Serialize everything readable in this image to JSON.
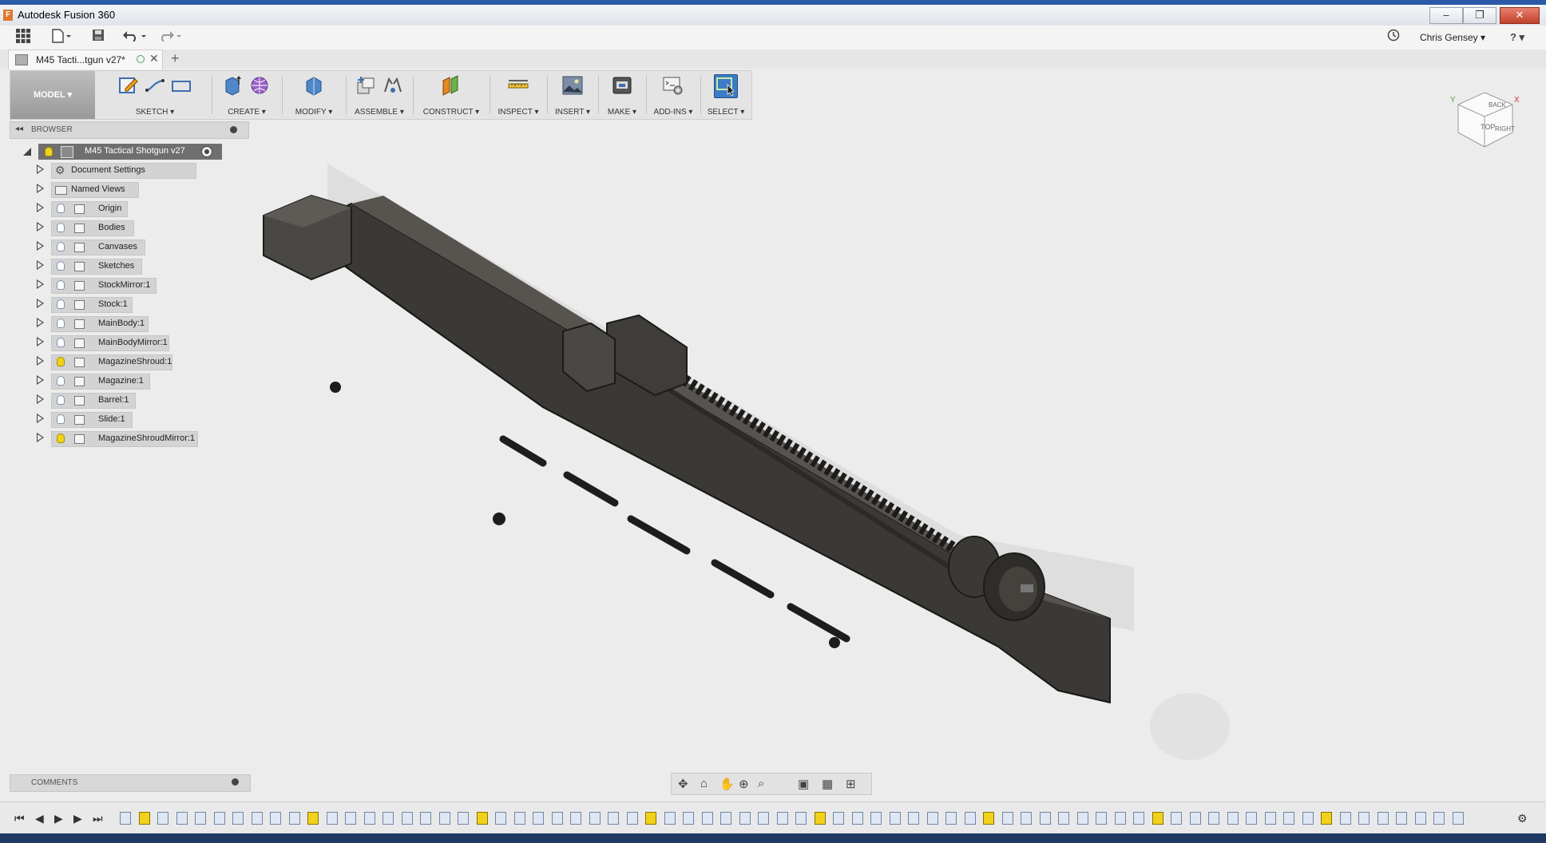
{
  "window": {
    "title": "Autodesk Fusion 360",
    "logo": "F",
    "controls": [
      "–",
      "❐",
      "✕"
    ]
  },
  "quickbar": {
    "user": "Chris Gensey ▾",
    "help": "? ▾"
  },
  "document_tab": {
    "label": "M45 Tacti...tgun v27*"
  },
  "toolbar": {
    "workspace": "MODEL ▾",
    "groups": [
      {
        "label": "SKETCH ▾"
      },
      {
        "label": "CREATE ▾"
      },
      {
        "label": "MODIFY ▾"
      },
      {
        "label": "ASSEMBLE ▾"
      },
      {
        "label": "CONSTRUCT ▾"
      },
      {
        "label": "INSPECT ▾"
      },
      {
        "label": "INSERT ▾"
      },
      {
        "label": "MAKE ▾"
      },
      {
        "label": "ADD-INS ▾"
      },
      {
        "label": "SELECT ▾"
      }
    ]
  },
  "browser": {
    "title": "BROWSER",
    "root": "M45 Tactical Shotgun v27",
    "items": [
      {
        "label": "Document Settings",
        "icon": "gear-icon",
        "bulb": "none"
      },
      {
        "label": "Named Views",
        "icon": "folder-icon",
        "bulb": "none"
      },
      {
        "label": "Origin",
        "icon": "folder-icon",
        "bulb": "off"
      },
      {
        "label": "Bodies",
        "icon": "folder-icon",
        "bulb": "off"
      },
      {
        "label": "Canvases",
        "icon": "folder-icon",
        "bulb": "off"
      },
      {
        "label": "Sketches",
        "icon": "folder-icon",
        "bulb": "off"
      },
      {
        "label": "StockMirror:1",
        "icon": "component-icon",
        "bulb": "off"
      },
      {
        "label": "Stock:1",
        "icon": "component-icon",
        "bulb": "off"
      },
      {
        "label": "MainBody:1",
        "icon": "component-icon",
        "bulb": "off"
      },
      {
        "label": "MainBodyMirror:1",
        "icon": "component-icon",
        "bulb": "off"
      },
      {
        "label": "MagazineShroud:1",
        "icon": "component-icon",
        "bulb": "on"
      },
      {
        "label": "Magazine:1",
        "icon": "component-icon",
        "bulb": "off"
      },
      {
        "label": "Barrel:1",
        "icon": "component-icon",
        "bulb": "off"
      },
      {
        "label": "Slide:1",
        "icon": "component-icon",
        "bulb": "off"
      },
      {
        "label": "MagazineShroudMirror:1",
        "icon": "component-icon",
        "bulb": "on"
      }
    ]
  },
  "viewcube": {
    "faces": [
      "TOP",
      "BACK",
      "RIGHT"
    ],
    "axes": [
      "Y",
      "X"
    ]
  },
  "comments": {
    "title": "COMMENTS"
  },
  "colors": {
    "model": "#3a3835",
    "accent": "#2d6db5",
    "bulb_on": "#f1d21a"
  }
}
